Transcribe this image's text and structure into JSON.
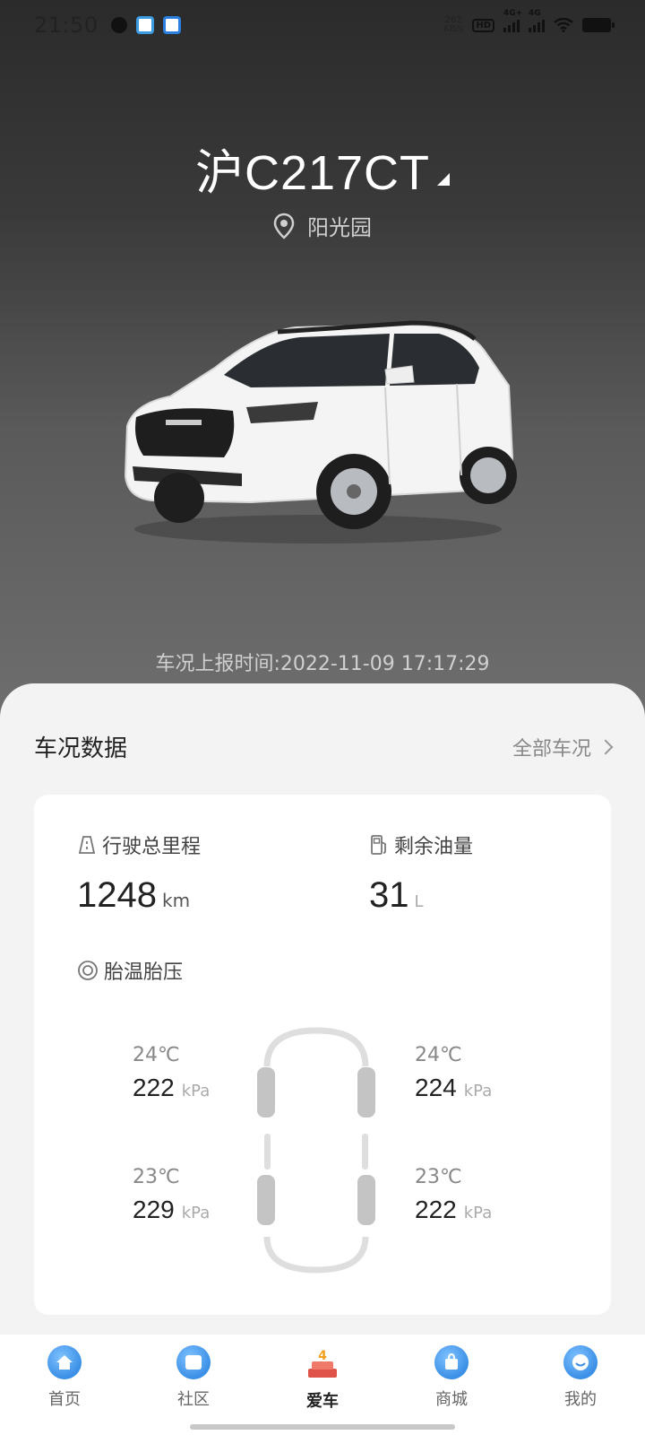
{
  "status_bar": {
    "time": "21:50",
    "net_speed_top": "262",
    "net_speed_bottom": "KB/s",
    "hd_label": "HD",
    "sig1_label": "4G+",
    "sig2_label": "4G"
  },
  "vehicle": {
    "plate": "沪C217CT",
    "location": "阳光园",
    "report_time": "车况上报时间:2022-11-09 17:17:29"
  },
  "section": {
    "title": "车况数据",
    "all_status": "全部车况"
  },
  "metrics": {
    "mileage_label": "行驶总里程",
    "mileage_value": "1248",
    "mileage_unit": "km",
    "fuel_label": "剩余油量",
    "fuel_value": "31",
    "fuel_unit": "L",
    "tire_label": "胎温胎压"
  },
  "tires": {
    "front_left": {
      "temp": "24℃",
      "pressure": "222",
      "unit": "kPa"
    },
    "front_right": {
      "temp": "24℃",
      "pressure": "224",
      "unit": "kPa"
    },
    "rear_left": {
      "temp": "23℃",
      "pressure": "229",
      "unit": "kPa"
    },
    "rear_right": {
      "temp": "23℃",
      "pressure": "222",
      "unit": "kPa"
    }
  },
  "nav": [
    {
      "label": "首页",
      "icon": "home-icon"
    },
    {
      "label": "社区",
      "icon": "community-icon"
    },
    {
      "label": "爱车",
      "icon": "car-cake-icon"
    },
    {
      "label": "商城",
      "icon": "shop-icon"
    },
    {
      "label": "我的",
      "icon": "profile-icon"
    }
  ],
  "colors": {
    "accent_blue": "#3a8fe6",
    "hero_dark": "#2b2b2b"
  }
}
